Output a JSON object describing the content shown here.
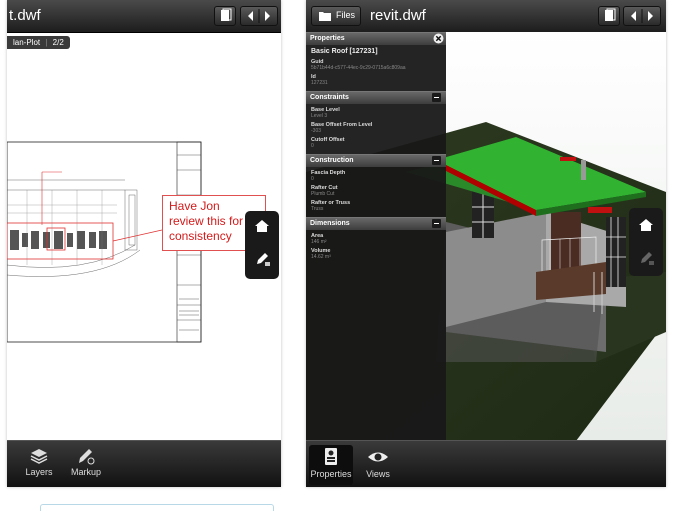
{
  "left": {
    "title": "t.dwf",
    "sheet_tab": "lan-Plot",
    "sheet_index": "2/2",
    "annotation": [
      "Have Jon",
      "review this for",
      "consistency"
    ],
    "bottom_tabs": [
      {
        "label": "Layers",
        "icon": "layers-icon"
      },
      {
        "label": "Markup",
        "icon": "markup-icon"
      }
    ]
  },
  "right": {
    "files_button": "Files",
    "title": "revit.dwf",
    "panel": {
      "header": "Properties",
      "element_name": "Basic Roof [127231]",
      "top_fields": [
        {
          "label": "Guid",
          "value": "5b71b44d-c577-44ec-9c29-0715a6c809aa"
        },
        {
          "label": "Id",
          "value": "127231"
        }
      ],
      "sections": [
        {
          "title": "Constraints",
          "fields": [
            {
              "label": "Base Level",
              "value": "Level 3"
            },
            {
              "label": "Base Offset From Level",
              "value": "-303"
            },
            {
              "label": "Cutoff Offset",
              "value": "0"
            }
          ]
        },
        {
          "title": "Construction",
          "fields": [
            {
              "label": "Fascia Depth",
              "value": "0"
            },
            {
              "label": "Rafter Cut",
              "value": "Plumb Cut"
            },
            {
              "label": "Rafter or Truss",
              "value": "Truss"
            }
          ]
        },
        {
          "title": "Dimensions",
          "fields": [
            {
              "label": "Area",
              "value": "146 m²"
            },
            {
              "label": "Volume",
              "value": "14.62 m³"
            }
          ]
        }
      ]
    },
    "bottom_tabs": [
      {
        "label": "Properties",
        "icon": "properties-icon",
        "active": true
      },
      {
        "label": "Views",
        "icon": "eye-icon"
      }
    ]
  },
  "colors": {
    "annotation": "#d31b1b",
    "roof": "#2db52d",
    "toolbar": "#2a2a2a"
  }
}
